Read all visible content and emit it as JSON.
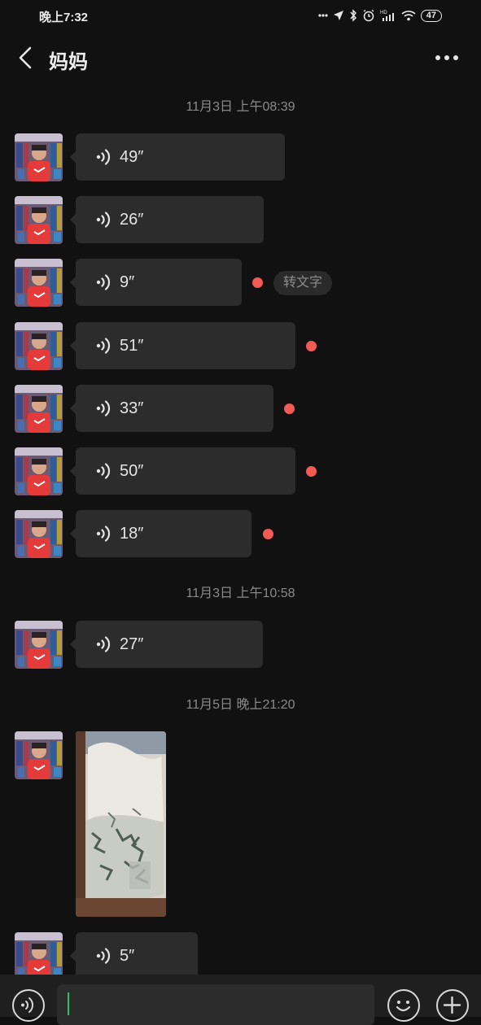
{
  "status_bar": {
    "time": "晚上7:32",
    "battery": "47",
    "icons": [
      "dots-icon",
      "location-icon",
      "bluetooth-icon",
      "alarm-icon",
      "hd-signal-icon",
      "wifi-icon",
      "battery-icon"
    ]
  },
  "header": {
    "title": "妈妈",
    "back_icon": "chevron-left-icon",
    "more_icon": "more-dots-icon"
  },
  "chat": {
    "timestamps": [
      "11月3日 上午08:39",
      "11月3日 上午10:58",
      "11月5日 晚上21:20"
    ],
    "voice_messages": [
      {
        "duration": "49″",
        "unread": false
      },
      {
        "duration": "26″",
        "unread": false
      },
      {
        "duration": "9″",
        "unread": true,
        "action_label": "转文字"
      },
      {
        "duration": "51″",
        "unread": true
      },
      {
        "duration": "33″",
        "unread": true
      },
      {
        "duration": "50″",
        "unread": true
      },
      {
        "duration": "18″",
        "unread": true
      },
      {
        "duration": "27″",
        "unread": false
      },
      {
        "duration": "5″",
        "unread": false
      }
    ],
    "image_message": {
      "type": "photo"
    }
  },
  "input_bar": {
    "voice_icon": "voice-toggle-icon",
    "text": "",
    "emoji_icon": "emoji-icon",
    "plus_icon": "plus-icon"
  },
  "colors": {
    "background": "#111111",
    "bubble": "#2c2c2c",
    "unread_dot": "#f25b55",
    "cursor": "#2bbf6a",
    "timestamp": "#8a8a8a"
  }
}
